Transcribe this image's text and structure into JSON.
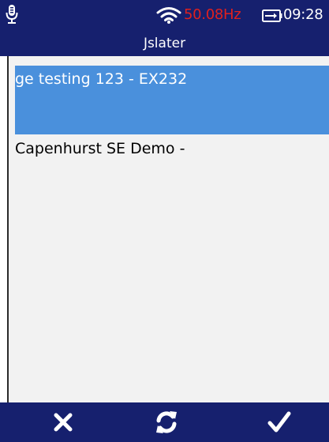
{
  "status_bar": {
    "mic_icon": "microphone-icon",
    "wifi_icon": "wifi-icon",
    "frequency": "50.08Hz",
    "frequency_color": "#e0201e",
    "battery_icon": "battery-charging-icon",
    "time": "09:28"
  },
  "header": {
    "title": "Jslater",
    "background": "#16206e"
  },
  "list": {
    "items": [
      {
        "label": "ge testing 123 - EX232",
        "selected": true
      },
      {
        "label": "Capenhurst SE Demo -",
        "selected": false
      }
    ],
    "selected_color": "#4a90dc"
  },
  "footer": {
    "cancel_icon": "close-icon",
    "refresh_icon": "refresh-icon",
    "confirm_icon": "checkmark-icon"
  }
}
